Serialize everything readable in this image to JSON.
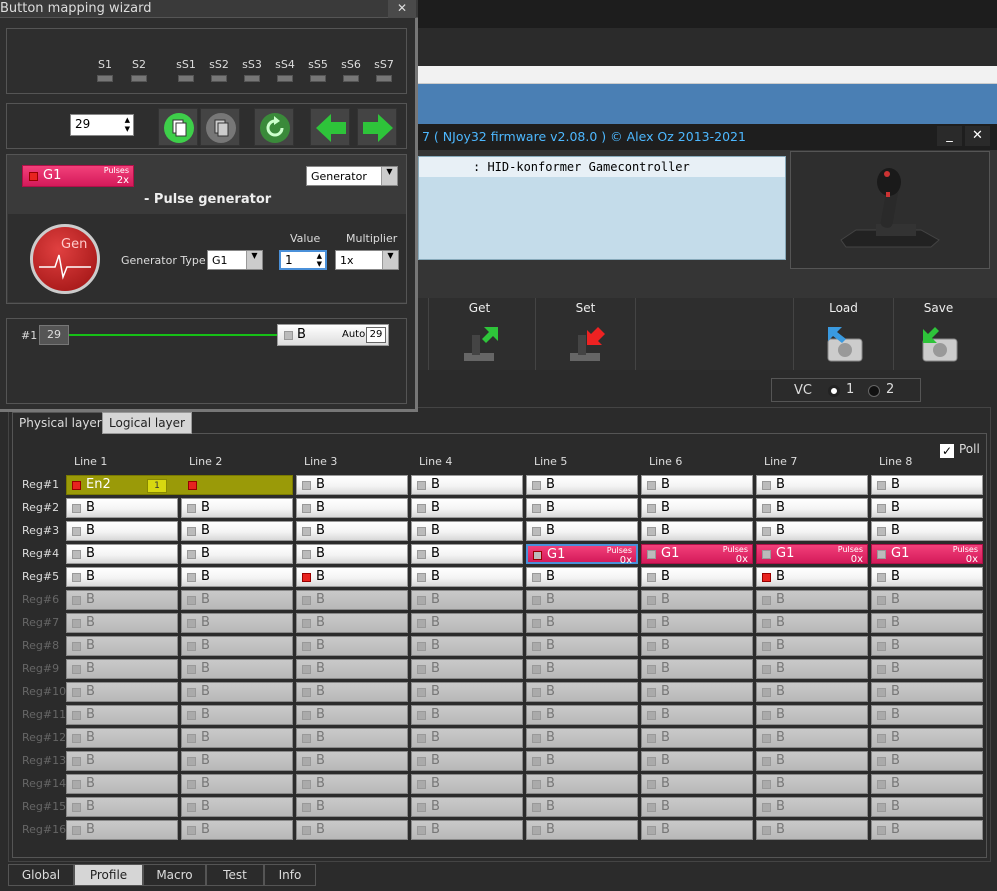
{
  "main": {
    "title": "7 ( NJoy32 firmware v2.08.0 ) © Alex Oz 2013-2021",
    "minimize": "_",
    "close": "✕",
    "device_header": ": HID-konformer Gamecontroller",
    "toolbar": [
      {
        "label": "Get"
      },
      {
        "label": "Set"
      },
      {
        "label": "Load"
      },
      {
        "label": "Save"
      }
    ],
    "vc": {
      "label": "VC",
      "opt1": "1",
      "opt2": "2"
    }
  },
  "layers": {
    "physical": "Physical layer",
    "logical": "Logical layer"
  },
  "poll": {
    "label": "Poll",
    "check": "✓"
  },
  "grid": {
    "columns": [
      "Line 1",
      "Line 2",
      "Line 3",
      "Line 4",
      "Line 5",
      "Line 6",
      "Line 7",
      "Line 8"
    ],
    "rows": [
      "Reg#1",
      "Reg#2",
      "Reg#3",
      "Reg#4",
      "Reg#5",
      "Reg#6",
      "Reg#7",
      "Reg#8",
      "Reg#9",
      "Reg#10",
      "Reg#11",
      "Reg#12",
      "Reg#13",
      "Reg#14",
      "Reg#15",
      "Reg#16"
    ],
    "default_label": "B",
    "en2": {
      "label": "En2",
      "badge": "1"
    },
    "pulse": {
      "label": "G1",
      "pulses": "Pulses",
      "count": "0x"
    }
  },
  "bottom_tabs": [
    "Global",
    "Profile",
    "Macro",
    "Test",
    "Info"
  ],
  "wizard": {
    "title": "Button mapping wizard",
    "close": "✕",
    "switches": [
      "S1",
      "S2",
      "sS1",
      "sS2",
      "sS3",
      "sS4",
      "sS5",
      "sS6",
      "sS7"
    ],
    "button_number": "29",
    "mapping": {
      "label": "G1",
      "pulses": "Pulses",
      "count": "2x"
    },
    "type_combo": "Generator",
    "section_title": "- Pulse generator",
    "gen_logo": "Gen",
    "gen_type_label": "Generator Type",
    "gen_type_value": "G1",
    "value_label": "Value",
    "value": "1",
    "multiplier_label": "Multiplier",
    "multiplier_value": "1x",
    "slider": {
      "index": "#1",
      "left_value": "29",
      "right_label": "B",
      "auto": "Auto",
      "right_value": "29"
    }
  },
  "colors": {
    "pulse": "#e0266a",
    "title_blue": "#4db8ff",
    "olive": "#9a9a08",
    "led_red": "#e8231f"
  }
}
